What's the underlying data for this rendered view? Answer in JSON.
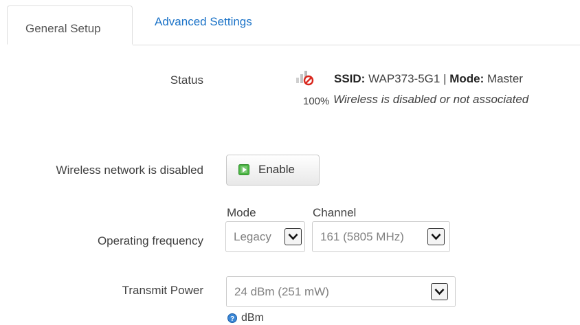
{
  "tabs": [
    {
      "label": "General Setup",
      "active": true
    },
    {
      "label": "Advanced Settings",
      "active": false
    }
  ],
  "status": {
    "label": "Status",
    "signal_percent": "100%",
    "ssid_key": "SSID:",
    "ssid_value": "WAP373-5G1",
    "separator": "|",
    "mode_key": "Mode:",
    "mode_value": "Master",
    "message": "Wireless is disabled or not associated",
    "icon": "signal-disabled-icon"
  },
  "wireless": {
    "label": "Wireless network is disabled",
    "button_label": "Enable",
    "button_icon": "play-icon"
  },
  "frequency": {
    "label": "Operating frequency",
    "mode_label": "Mode",
    "mode_value": "Legacy",
    "channel_label": "Channel",
    "channel_value": "161 (5805 MHz)"
  },
  "transmit": {
    "label": "Transmit Power",
    "value": "24 dBm (251 mW)",
    "help_icon": "help-icon",
    "unit": "dBm"
  },
  "colors": {
    "link": "#1a72c7",
    "text": "#404040",
    "border": "#dddddd",
    "disabled_red": "#d9261c"
  }
}
